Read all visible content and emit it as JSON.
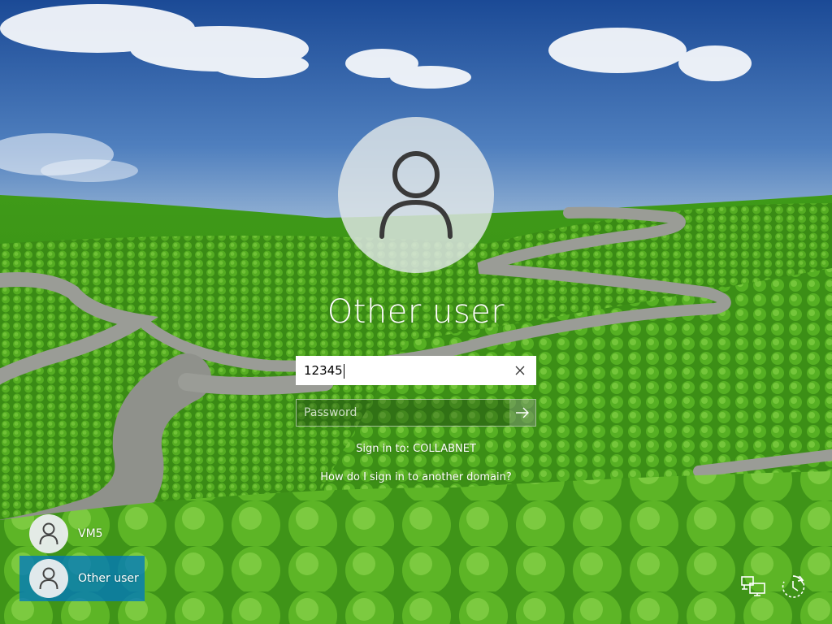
{
  "login": {
    "user_title": "Other user",
    "username_value": "12345",
    "password_placeholder": "Password",
    "sign_in_to": "Sign in to: COLLABNET",
    "domain_help_link": "How do I sign in to another domain?"
  },
  "user_list": [
    {
      "label": "VM5",
      "selected": false,
      "icon": "user-avatar-icon"
    },
    {
      "label": "Other user",
      "selected": true,
      "icon": "user-avatar-icon"
    }
  ],
  "corner_icons": [
    {
      "name": "network-icon"
    },
    {
      "name": "accessibility-icon"
    }
  ],
  "colors": {
    "selected_tile": "#0078be",
    "sky_top": "#1d4f9a",
    "grass": "#4fa21c"
  }
}
